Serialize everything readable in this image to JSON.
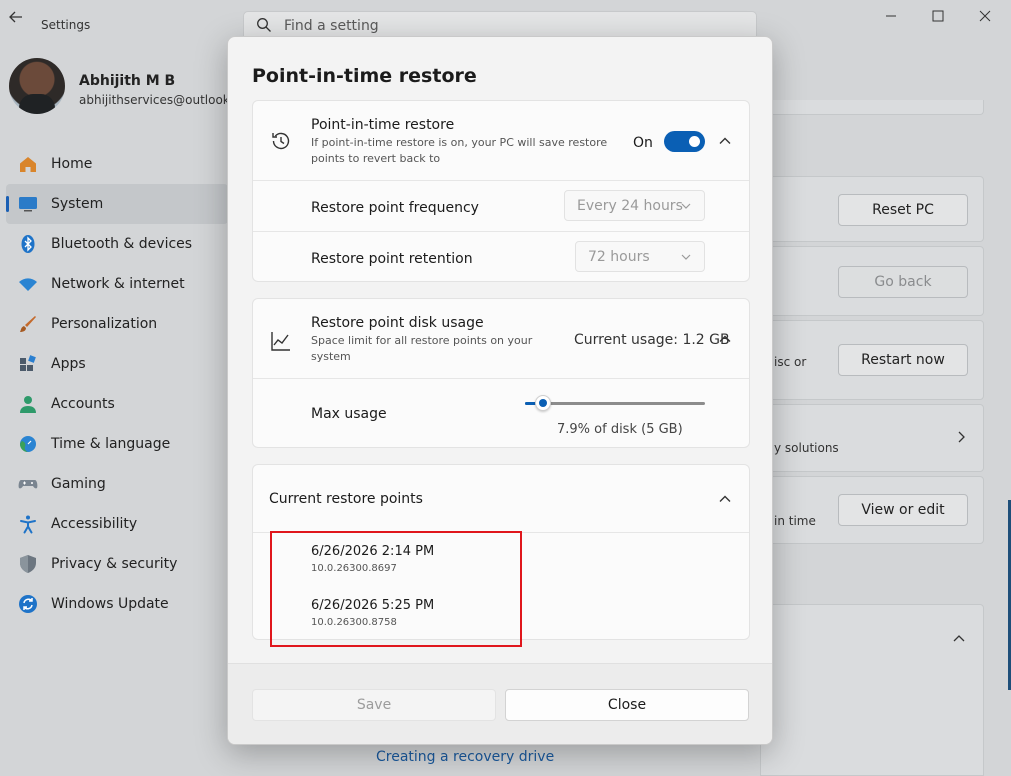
{
  "window": {
    "app_title": "Settings",
    "search_placeholder": "Find a setting"
  },
  "profile": {
    "name": "Abhijith M B",
    "email": "abhijithservices@outlook.com"
  },
  "nav": {
    "items": [
      {
        "label": "Home",
        "icon": "home-icon"
      },
      {
        "label": "System",
        "icon": "system-icon",
        "active": true
      },
      {
        "label": "Bluetooth & devices",
        "icon": "bluetooth-icon"
      },
      {
        "label": "Network & internet",
        "icon": "wifi-icon"
      },
      {
        "label": "Personalization",
        "icon": "brush-icon"
      },
      {
        "label": "Apps",
        "icon": "apps-icon"
      },
      {
        "label": "Accounts",
        "icon": "accounts-icon"
      },
      {
        "label": "Time & language",
        "icon": "globe-icon"
      },
      {
        "label": "Gaming",
        "icon": "gamepad-icon"
      },
      {
        "label": "Accessibility",
        "icon": "accessibility-icon"
      },
      {
        "label": "Privacy & security",
        "icon": "shield-icon"
      },
      {
        "label": "Windows Update",
        "icon": "update-icon"
      }
    ]
  },
  "background": {
    "reset_pc": "Reset PC",
    "go_back": "Go back",
    "restart_now": "Restart now",
    "view_or_edit": "View or edit",
    "disc_or": "isc or",
    "solutions": "y solutions",
    "in_time": "in time",
    "recovery_link": "Creating a recovery drive"
  },
  "dialog": {
    "title": "Point-in-time restore",
    "pitr": {
      "title": "Point-in-time restore",
      "subtitle": "If point-in-time restore is on, your PC will save restore points to revert back to",
      "toggle_state": "On",
      "enabled": true
    },
    "frequency": {
      "label": "Restore point frequency",
      "value": "Every 24 hours"
    },
    "retention": {
      "label": "Restore point retention",
      "value": "72 hours"
    },
    "disk_usage": {
      "title": "Restore point disk usage",
      "subtitle": "Space limit for all restore points on your system",
      "current": "Current usage: 1.2 GB"
    },
    "max_usage": {
      "label": "Max usage",
      "value_text": "7.9% of disk (5 GB)",
      "fraction": 0.1
    },
    "restore_points": {
      "label": "Current restore points",
      "items": [
        {
          "date": "6/26/2026 2:14 PM",
          "version": "10.0.26300.8697"
        },
        {
          "date": "6/26/2026 5:25 PM",
          "version": "10.0.26300.8758"
        }
      ]
    },
    "buttons": {
      "save": "Save",
      "close": "Close"
    }
  }
}
